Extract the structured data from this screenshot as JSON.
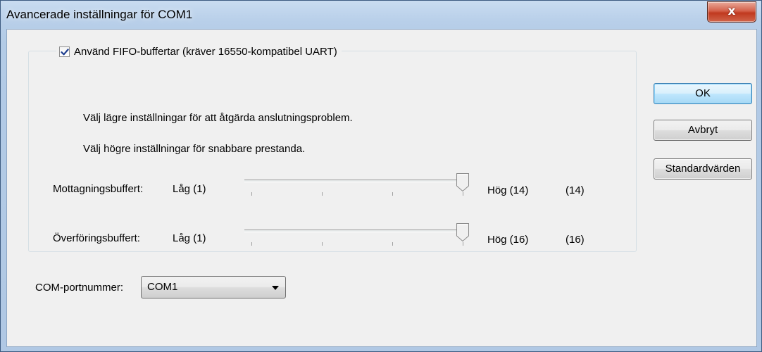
{
  "window": {
    "title": "Avancerade inställningar för COM1",
    "close_glyph": "x"
  },
  "fifo": {
    "checkbox_label": "Använd FIFO-buffertar (kräver 16550-kompatibel UART)",
    "checked": true,
    "hint_low": "Välj lägre inställningar för att åtgärda anslutningsproblem.",
    "hint_high": "Välj högre inställningar för snabbare prestanda."
  },
  "receive_buffer": {
    "label": "Mottagningsbuffert:",
    "min_label": "Låg (1)",
    "max_label": "Hög (14)",
    "current": "(14)",
    "value_fraction": 1.0
  },
  "transmit_buffer": {
    "label": "Överföringsbuffert:",
    "min_label": "Låg (1)",
    "max_label": "Hög (16)",
    "current": "(16)",
    "value_fraction": 1.0
  },
  "buttons": {
    "ok": "OK",
    "cancel": "Avbryt",
    "defaults": "Standardvärden"
  },
  "com_port": {
    "label": "COM-portnummer:",
    "selected": "COM1"
  },
  "icons": {
    "checkbox_check": "check-icon",
    "dropdown": "chevron-down-icon",
    "close": "close-icon"
  }
}
